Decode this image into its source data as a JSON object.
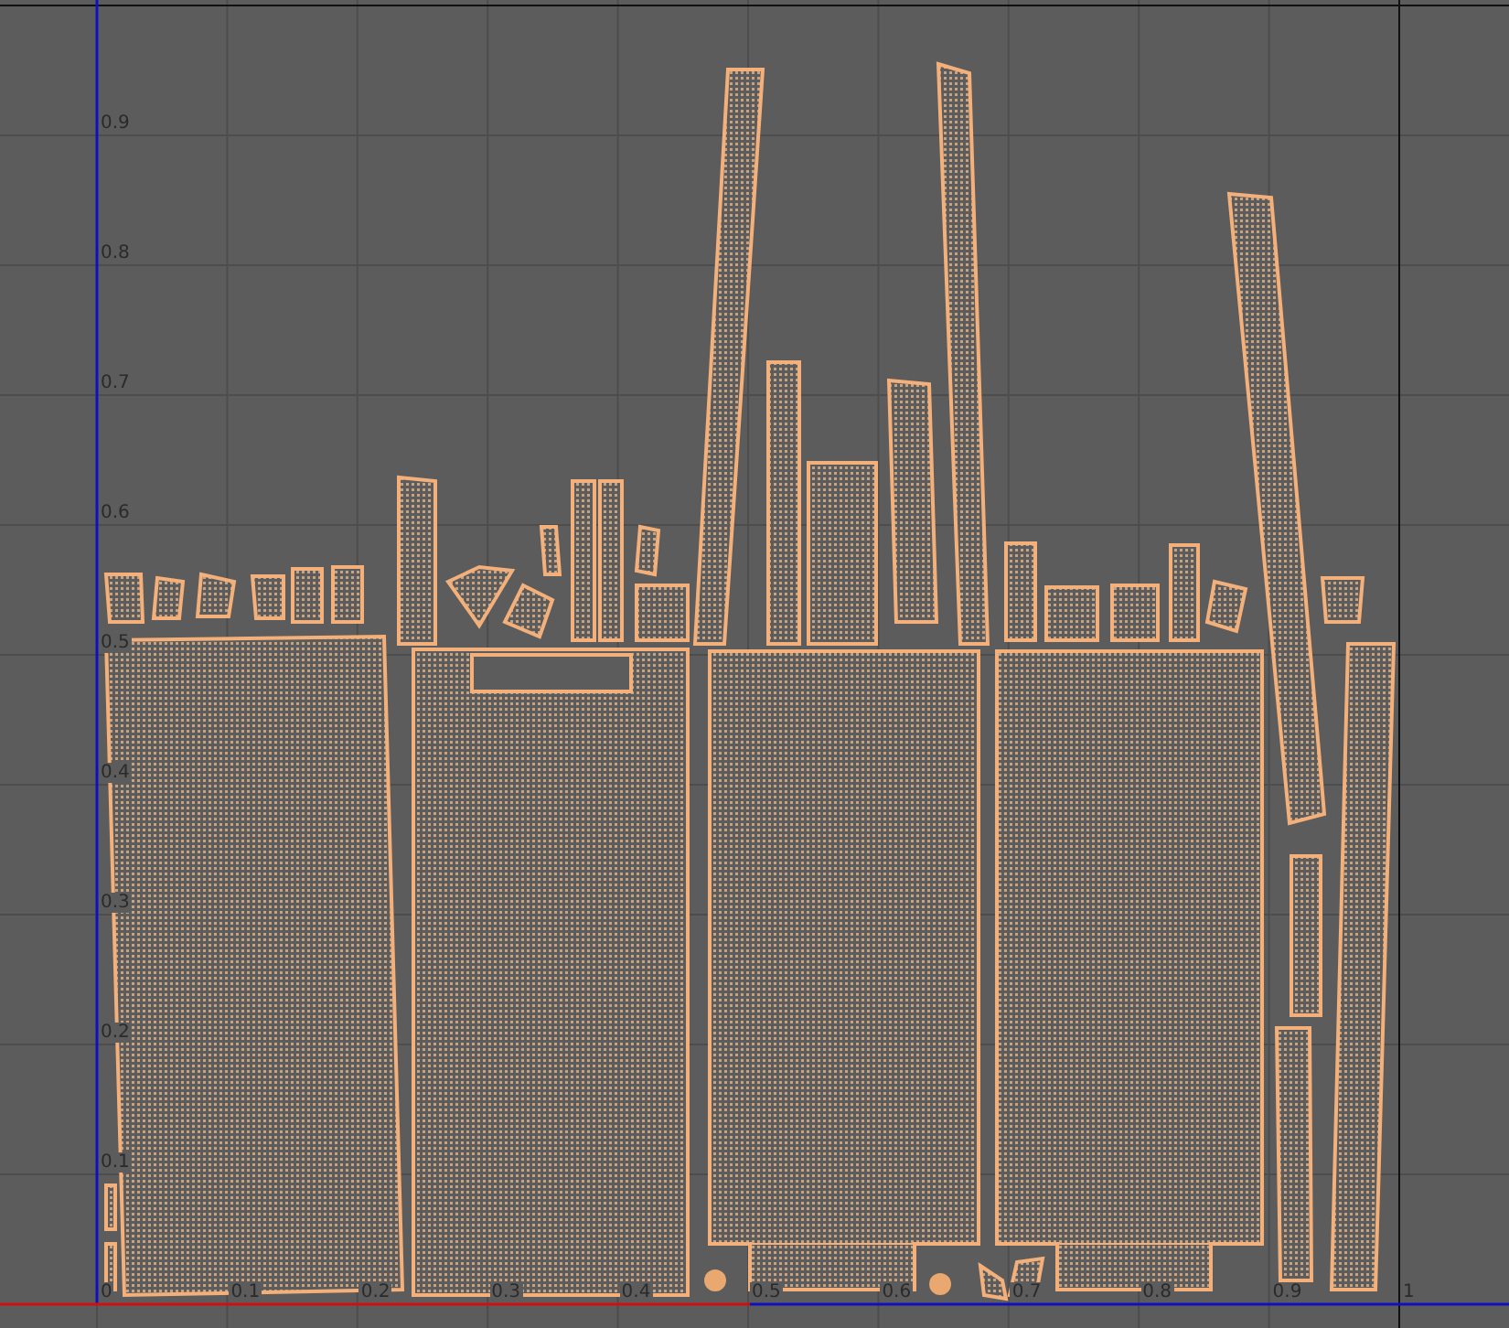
{
  "uv_editor": {
    "y_axis_labels": [
      "0.9",
      "0.8",
      "0.7",
      "0.6",
      "0.5",
      "0.4",
      "0.3",
      "0.2",
      "0.1",
      "0"
    ],
    "x_axis_labels": [
      "0.1",
      "0.2",
      "0.3",
      "0.4",
      "0.5",
      "0.6",
      "0.7",
      "0.8",
      "0.9",
      "1"
    ]
  }
}
